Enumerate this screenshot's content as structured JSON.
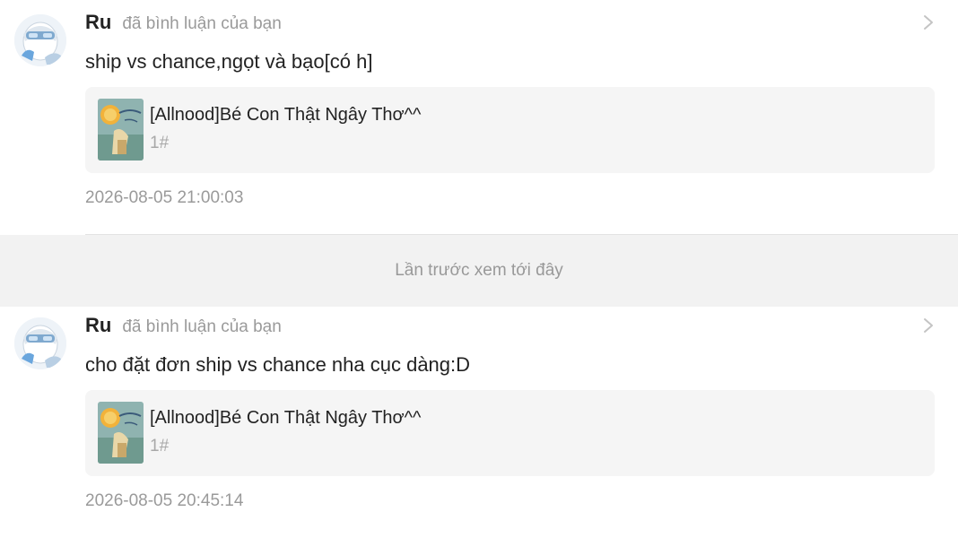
{
  "notifications": [
    {
      "username": "Ru",
      "action": "đã bình luận của bạn",
      "comment": "ship vs chance,ngọt và bạo[có h]",
      "post": {
        "title": "[Allnood]Bé Con Thật Ngây Thơ^^",
        "floor": "1#"
      },
      "timestamp": "2026-08-05 21:00:03"
    },
    {
      "username": "Ru",
      "action": "đã bình luận của bạn",
      "comment": "cho đặt đơn ship vs chance nha cục dàng:D",
      "post": {
        "title": "[Allnood]Bé Con Thật Ngây Thơ^^",
        "floor": "1#"
      },
      "timestamp": "2026-08-05 20:45:14"
    }
  ],
  "separator": {
    "label": "Lần trước xem tới đây"
  },
  "icons": {
    "chevron": "chevron-right-icon",
    "avatar": "user-avatar",
    "cover": "story-cover"
  },
  "colors": {
    "background": "#ffffff",
    "separator_bg": "#f2f2f2",
    "card_bg": "#f5f5f5",
    "muted_text": "#9a9a9a",
    "primary_text": "#222222"
  }
}
